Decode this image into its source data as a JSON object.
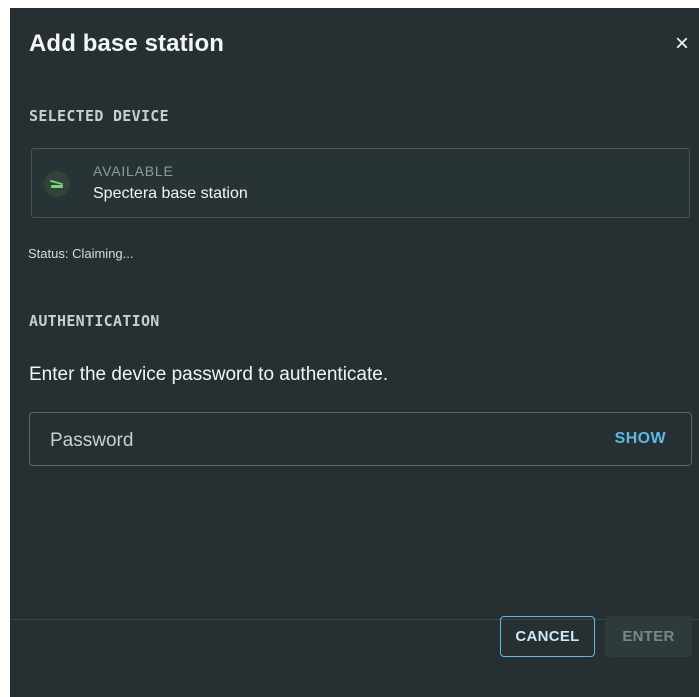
{
  "dialog": {
    "title": "Add base station",
    "close_glyph": "×"
  },
  "selected_device": {
    "section_label": "SELECTED DEVICE",
    "status": "AVAILABLE",
    "name": "Spectera base station",
    "icon": "base-station-icon",
    "icon_color": "#7fd07a"
  },
  "status_line": "Status: Claiming...",
  "authentication": {
    "section_label": "AUTHENTICATION",
    "instructions": "Enter the device password to authenticate.",
    "password": {
      "value": "",
      "placeholder": "Password",
      "show_label": "SHOW"
    }
  },
  "footer": {
    "cancel_label": "CANCEL",
    "enter_label": "ENTER"
  },
  "colors": {
    "background": "#263033",
    "accent": "#5fb7e6",
    "disabled_text": "#7b878c"
  }
}
